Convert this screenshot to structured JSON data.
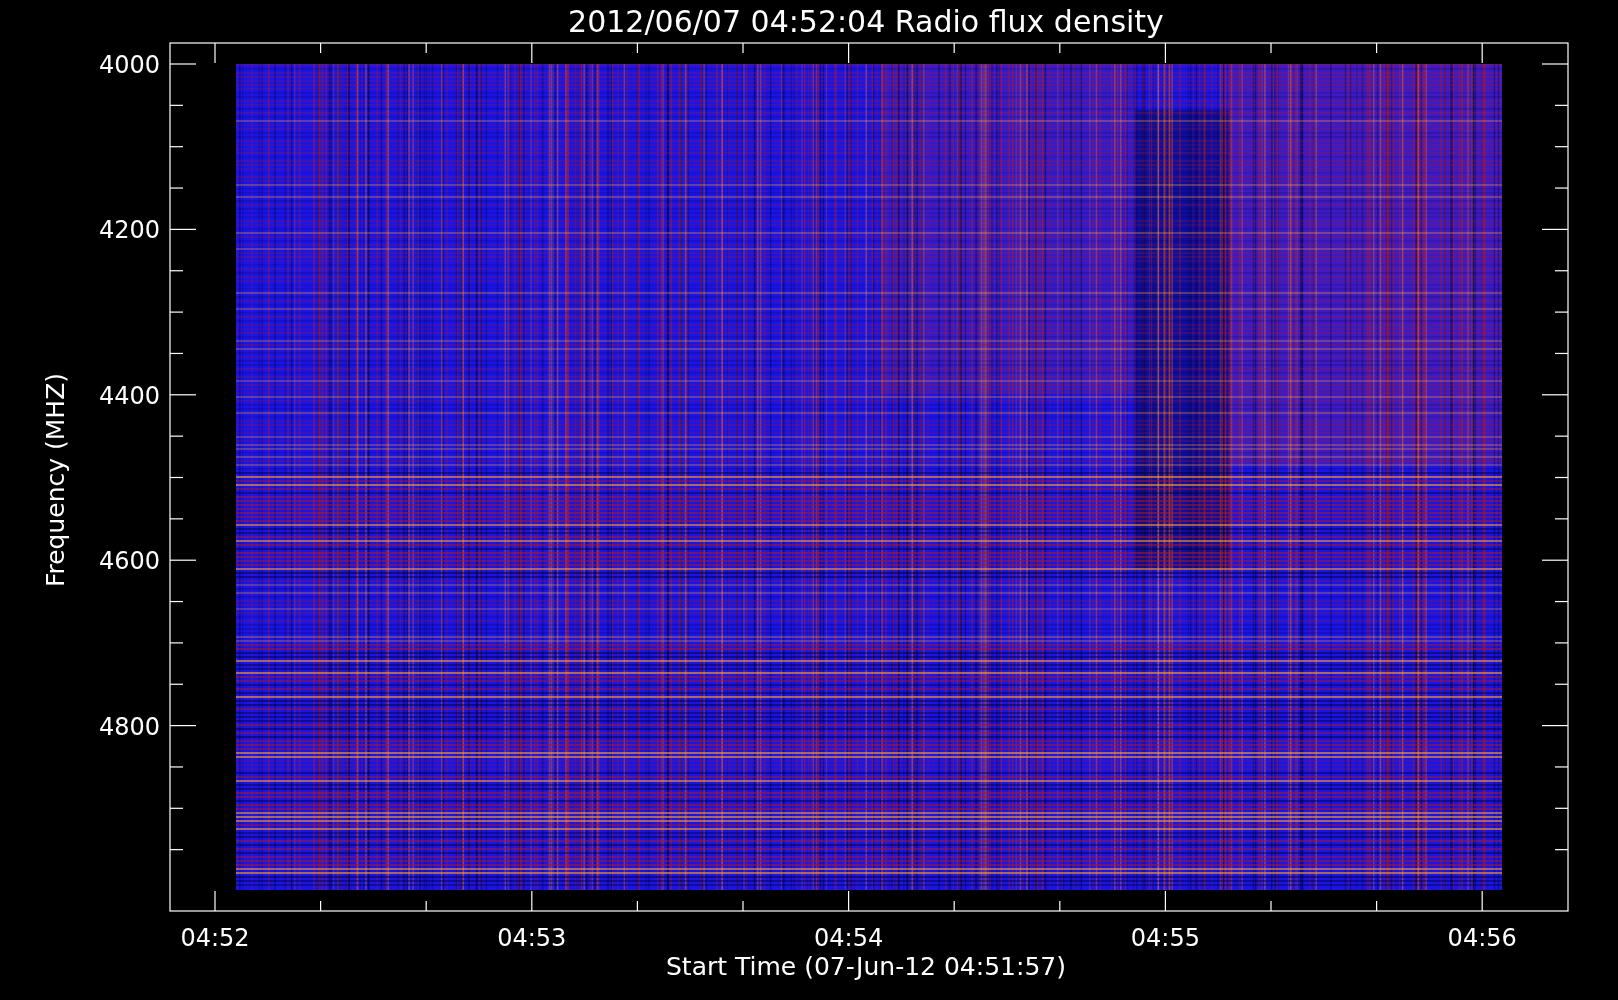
{
  "plot": {
    "title": "2012/06/07 04:52:04 Radio flux density",
    "xlabel": "Start Time (07-Jun-12 04:51:57)",
    "ylabel": "Frequency (MHZ)",
    "xtick_labels": [
      "04:52",
      "04:53",
      "04:54",
      "04:55",
      "04:56"
    ],
    "ytick_labels": [
      "4000",
      "4200",
      "4400",
      "4600",
      "4800"
    ]
  }
}
